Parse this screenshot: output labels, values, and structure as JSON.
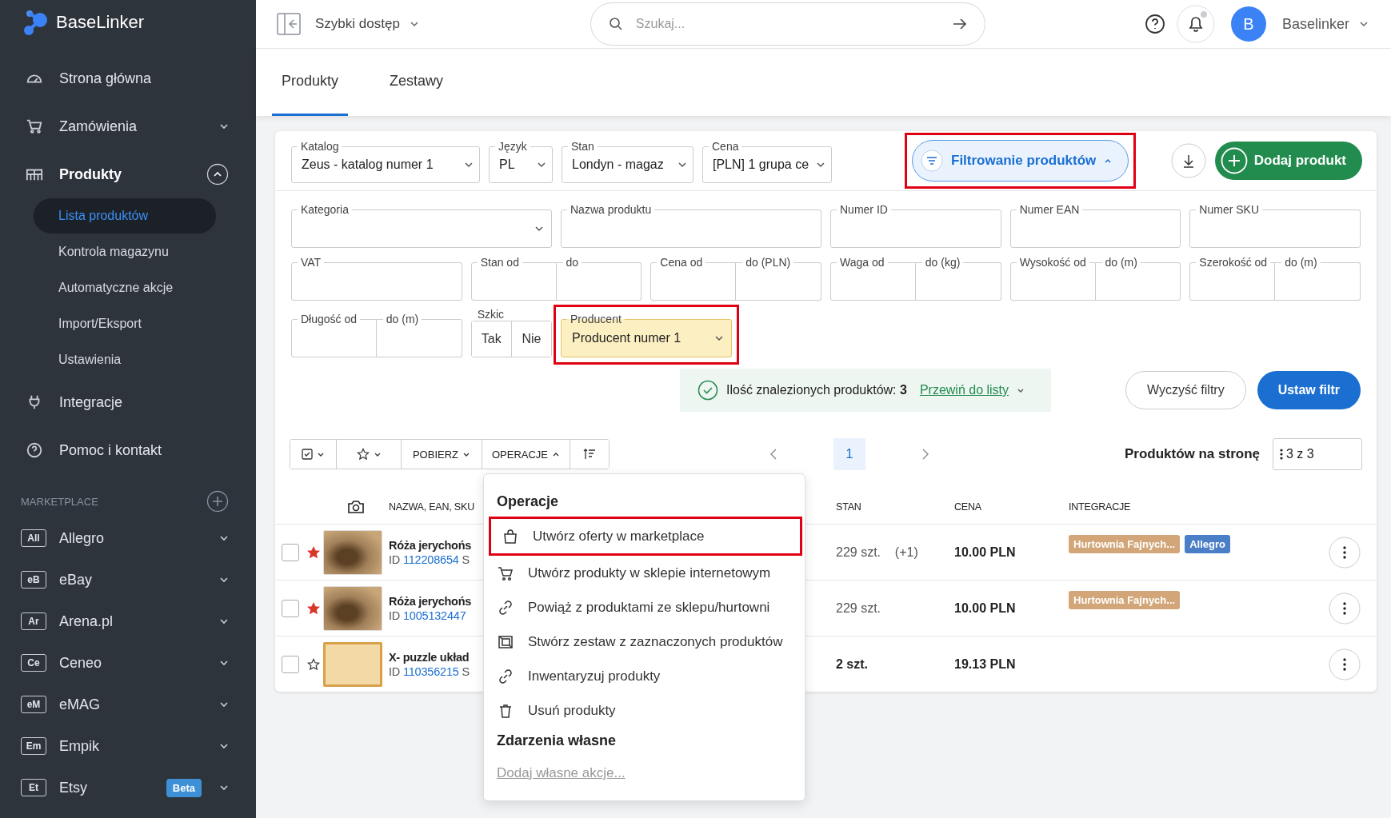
{
  "sidebar": {
    "logo": "BaseLinker",
    "nav": [
      {
        "label": "Strona główna"
      },
      {
        "label": "Zamówienia",
        "expanded": false
      },
      {
        "label": "Produkty",
        "expanded": true,
        "children": [
          {
            "label": "Lista produktów",
            "selected": true
          },
          {
            "label": "Kontrola magazynu",
            "selected": false
          },
          {
            "label": "Automatyczne akcje",
            "selected": false
          },
          {
            "label": "Import/Eksport",
            "selected": false
          },
          {
            "label": "Ustawienia",
            "selected": false
          }
        ]
      },
      {
        "label": "Integracje"
      },
      {
        "label": "Pomoc i kontakt"
      }
    ],
    "marketplace_heading": "MARKETPLACE",
    "marketplaces": [
      {
        "code": "All",
        "label": "Allegro"
      },
      {
        "code": "eB",
        "label": "eBay"
      },
      {
        "code": "Ar",
        "label": "Arena.pl"
      },
      {
        "code": "Ce",
        "label": "Ceneo"
      },
      {
        "code": "eM",
        "label": "eMAG"
      },
      {
        "code": "Em",
        "label": "Empik"
      },
      {
        "code": "Et",
        "label": "Etsy",
        "badge": "Beta"
      }
    ]
  },
  "topbar": {
    "quick_access": "Szybki dostęp",
    "search_placeholder": "Szukaj...",
    "avatar": "B",
    "user": "Baselinker"
  },
  "tabs": [
    {
      "label": "Produkty",
      "selected": true
    },
    {
      "label": "Zestawy",
      "selected": false
    }
  ],
  "selectors": [
    {
      "label": "Katalog",
      "value": "Zeus - katalog numer 1"
    },
    {
      "label": "Język",
      "value": "PL"
    },
    {
      "label": "Stan",
      "value": "Londyn - magaz"
    },
    {
      "label": "Cena",
      "value": "[PLN] 1 grupa ce"
    }
  ],
  "filter_toggle": {
    "label": "Filtrowanie produktów",
    "expanded": true,
    "highlighted": true
  },
  "add_button": "Dodaj produkt",
  "filters": [
    [
      {
        "kind": "select",
        "label": "Kategoria"
      },
      {
        "kind": "text",
        "label": "Nazwa produktu"
      },
      {
        "kind": "text",
        "label": "Numer ID"
      },
      {
        "kind": "text",
        "label": "Numer EAN"
      },
      {
        "kind": "text",
        "label": "Numer SKU"
      }
    ],
    [
      {
        "kind": "text",
        "label": "VAT"
      },
      {
        "kind": "range",
        "label": "Stan od",
        "label2": "do"
      },
      {
        "kind": "range",
        "label": "Cena od",
        "label2": "do (PLN)"
      },
      {
        "kind": "range",
        "label": "Waga od",
        "label2": "do (kg)"
      },
      {
        "kind": "range",
        "label": "Wysokość od",
        "label2": "do (m)"
      },
      {
        "kind": "range",
        "label": "Szerokość od",
        "label2": "do (m)"
      }
    ],
    [
      {
        "kind": "range",
        "label": "Długość od",
        "label2": "do (m)"
      },
      {
        "kind": "toggle",
        "label": "Szkic",
        "options": [
          "Tak",
          "Nie"
        ]
      },
      {
        "kind": "select",
        "label": "Producent",
        "value": "Producent numer 1",
        "active": true,
        "highlighted": true
      }
    ]
  ],
  "results": {
    "text": "Ilość znalezionych produktów: **3**",
    "link": "Przewiń do listy"
  },
  "filter_buttons": {
    "clear": "Wyczyść filtry",
    "apply": "Ustaw filtr"
  },
  "toolbar": {
    "download": "POBIERZ",
    "operations": "OPERACJE",
    "operations_open": true
  },
  "pagination": {
    "pages": [
      {
        "label": "1",
        "selected": true
      }
    ],
    "per_page_label": "Produktów na stronę",
    "per_page_value": "3 z 3"
  },
  "table": {
    "columns": [
      "NAZWA, EAN, SKU",
      "STAN",
      "CENA",
      "INTEGRACJE"
    ],
    "rows": [
      {
        "checked": false,
        "starred": true,
        "name": "Róża jerychońs",
        "id_label": "ID",
        "id": "112208654",
        "id_rest": "S",
        "stock": "229 szt.",
        "stock_change": "(+1)",
        "stock_bold": false,
        "price": "10.00 PLN",
        "tags": [
          {
            "label": "Hurtownia Fajnych...",
            "color": "#d2a679"
          },
          {
            "label": "Allegro",
            "color": "#4a7fc8"
          }
        ]
      },
      {
        "checked": false,
        "starred": true,
        "name": "Róża jerychońs",
        "id_label": "ID",
        "id": "1005132447",
        "stock": "229 szt.",
        "stock_bold": false,
        "price": "10.00 PLN",
        "tags": [
          {
            "label": "Hurtownia Fajnych...",
            "color": "#d2a679"
          }
        ]
      },
      {
        "checked": false,
        "starred": false,
        "name": "X- puzzle układ",
        "id_label": "ID",
        "id": "110356215",
        "id_rest": "S",
        "stock": "2 szt.",
        "stock_bold": true,
        "price": "19.13 PLN",
        "tags": []
      }
    ]
  },
  "operations_menu": {
    "title": "Operacje",
    "items": [
      {
        "label": "Utwórz oferty w marketplace",
        "highlighted": true
      },
      {
        "label": "Utwórz produkty w sklepie internetowym",
        "highlighted": false
      },
      {
        "label": "Powiąż z produktami ze sklepu/hurtowni",
        "highlighted": false
      },
      {
        "label": "Stwórz zestaw z zaznaczonych produktów",
        "highlighted": false
      },
      {
        "label": "Inwentaryzuj produkty",
        "highlighted": false
      },
      {
        "label": "Usuń produkty",
        "highlighted": false
      }
    ],
    "custom_title": "Zdarzenia własne",
    "custom_link": "Dodaj własne akcje..."
  }
}
